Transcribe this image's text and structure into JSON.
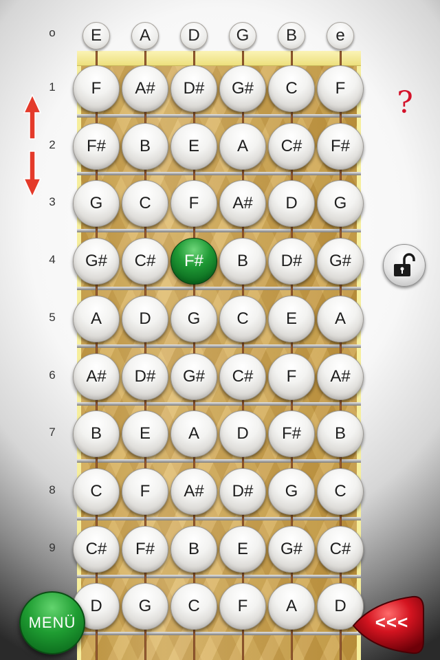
{
  "open_strings": [
    "E",
    "A",
    "D",
    "G",
    "B",
    "e"
  ],
  "fret_numbers": [
    "o",
    "1",
    "2",
    "3",
    "4",
    "5",
    "6",
    "7",
    "8",
    "9"
  ],
  "fret_rows": [
    [
      "F",
      "A#",
      "D#",
      "G#",
      "C",
      "F"
    ],
    [
      "F#",
      "B",
      "E",
      "A",
      "C#",
      "F#"
    ],
    [
      "G",
      "C",
      "F",
      "A#",
      "D",
      "G"
    ],
    [
      "G#",
      "C#",
      "F#",
      "B",
      "D#",
      "G#"
    ],
    [
      "A",
      "D",
      "G",
      "C",
      "E",
      "A"
    ],
    [
      "A#",
      "D#",
      "G#",
      "C#",
      "F",
      "A#"
    ],
    [
      "B",
      "E",
      "A",
      "D",
      "F#",
      "B"
    ],
    [
      "C",
      "F",
      "A#",
      "D#",
      "G",
      "C"
    ],
    [
      "C#",
      "F#",
      "B",
      "E",
      "G#",
      "C#"
    ],
    [
      "D",
      "G",
      "C",
      "F",
      "A",
      "D"
    ]
  ],
  "selected_note": {
    "fret": 4,
    "string": 3,
    "label": "F#"
  },
  "controls": {
    "help_label": "?",
    "menu_label": "MENÜ",
    "back_label": "<<<",
    "scroll_up_icon": "arrow-up-icon",
    "scroll_down_icon": "arrow-down-icon",
    "lock_icon": "unlocked-padlock-icon"
  },
  "colors": {
    "selected_note": "#1f9a35",
    "help": "#d4122a",
    "arrows": "#e43a2a",
    "menu_button": "#1f9d32",
    "back_button": "#d41420"
  }
}
